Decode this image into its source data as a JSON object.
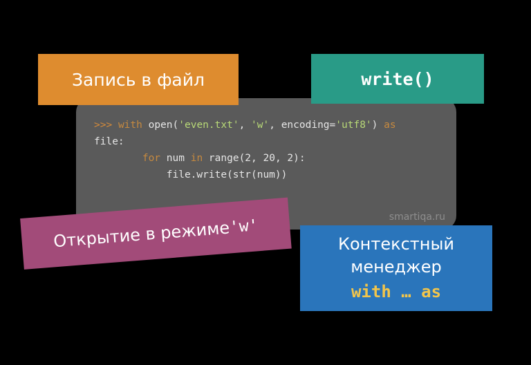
{
  "cards": {
    "orange": "Запись в файл",
    "teal": "write()",
    "purple_prefix": "Открытие в режиме ",
    "purple_mode": "'w'",
    "blue_line1": "Контекстный",
    "blue_line2": "менеджер",
    "blue_with_as": "with … as"
  },
  "code": {
    "prompt": ">>>",
    "kw_with": "with",
    "fn_open": "open",
    "paren_open": "(",
    "str_file": "'even.txt'",
    "comma1": ", ",
    "str_mode": "'w'",
    "comma2": ", ",
    "arg_enc": "encoding=",
    "str_enc": "'utf8'",
    "paren_close": ")",
    "kw_as": "as",
    "var_file": "file",
    "colon": ":",
    "kw_for": "for",
    "var_num": "num",
    "kw_in": "in",
    "fn_range": "range",
    "range_args": "(2, 20, 2)",
    "colon2": ":",
    "body": "file.write(str(num))"
  },
  "site": "smartiqa.ru"
}
